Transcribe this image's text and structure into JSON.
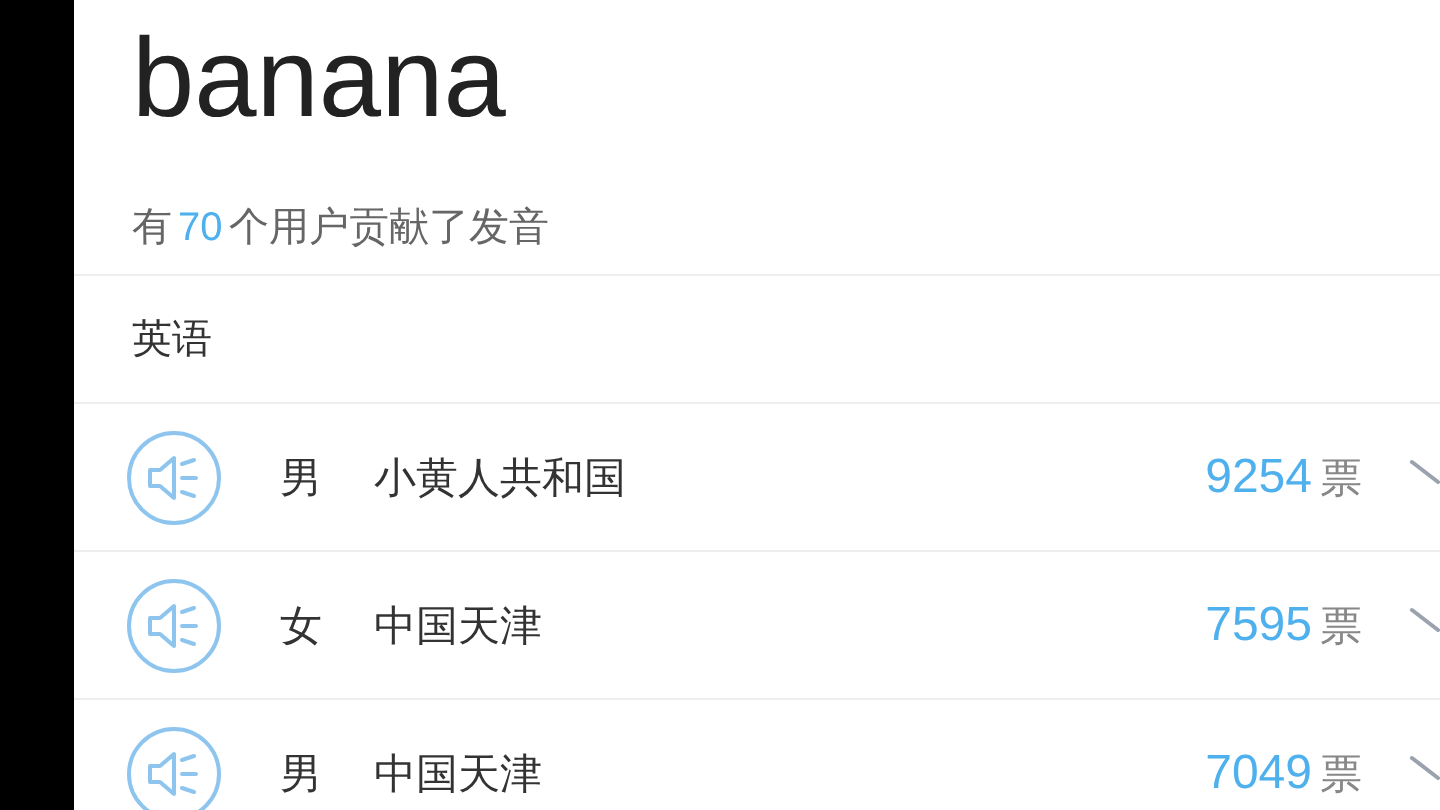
{
  "word": "banana",
  "contributors": {
    "prefix": "有",
    "count": "70",
    "suffix": "个用户贡献了发音"
  },
  "section": "英语",
  "pronunciations": [
    {
      "gender": "男",
      "region": "小黄人共和国",
      "votes": "9254",
      "unit": "票"
    },
    {
      "gender": "女",
      "region": "中国天津",
      "votes": "7595",
      "unit": "票"
    },
    {
      "gender": "男",
      "region": "中国天津",
      "votes": "7049",
      "unit": "票"
    }
  ]
}
